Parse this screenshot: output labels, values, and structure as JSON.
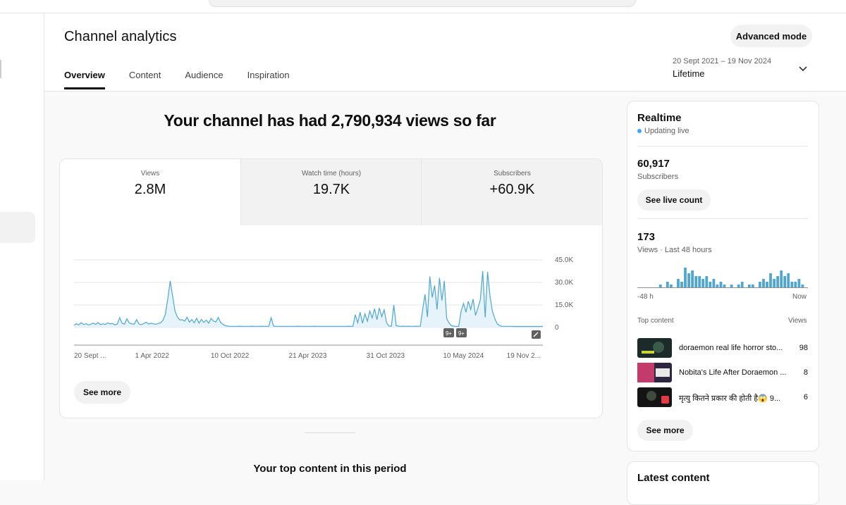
{
  "header": {
    "title": "Channel analytics",
    "advanced_button": "Advanced mode",
    "tabs": [
      {
        "label": "Overview"
      },
      {
        "label": "Content"
      },
      {
        "label": "Audience"
      },
      {
        "label": "Inspiration"
      }
    ],
    "date_range": "20 Sept 2021 – 19 Nov 2024",
    "date_label": "Lifetime"
  },
  "main": {
    "headline": "Your channel has had 2,790,934 views so far",
    "metrics": [
      {
        "label": "Views",
        "value": "2.8M"
      },
      {
        "label": "Watch time (hours)",
        "value": "19.7K"
      },
      {
        "label": "Subscribers",
        "value": "+60.9K"
      }
    ],
    "see_more": "See more",
    "top_content_title": "Your top content in this period",
    "badges": [
      "9+",
      "9+"
    ]
  },
  "chart_data": {
    "type": "line",
    "x_ticks": [
      "20 Sept ...",
      "1 Apr 2022",
      "10 Oct 2022",
      "21 Apr 2023",
      "31 Oct 2023",
      "10 May 2024",
      "19 Nov 2..."
    ],
    "y_ticks": [
      "45.0K",
      "30.0K",
      "15.0K",
      "0"
    ],
    "ylim": [
      0,
      45000
    ],
    "series": [
      {
        "color": "#4fa6cf",
        "values": [
          1500,
          2500,
          1800,
          3200,
          2000,
          2600,
          1700,
          2200,
          2900,
          2100,
          3300,
          1900,
          2500,
          2000,
          3100,
          2400,
          2700,
          1800,
          2300,
          6500,
          2900,
          2200,
          5800,
          3000,
          2500,
          2200,
          5200,
          2400,
          1900,
          2600,
          3500,
          2300,
          2800,
          2500,
          2100,
          2700,
          3200,
          4800,
          9000,
          19000,
          31000,
          21000,
          11000,
          7000,
          5000,
          5200,
          4200,
          6800,
          3600,
          5300,
          3100,
          6200,
          2900,
          5400,
          3400,
          4900,
          2800,
          6100,
          4300,
          3700,
          6700,
          3300,
          2000,
          1200,
          900,
          800,
          800,
          800,
          800,
          900,
          800,
          800,
          800,
          800,
          900,
          800,
          800,
          800,
          900,
          800,
          800,
          800,
          6500,
          900,
          800,
          800,
          800,
          800,
          800,
          800,
          800,
          800,
          800,
          900,
          800,
          800,
          800,
          800,
          800,
          800,
          900,
          800,
          800,
          800,
          800,
          800,
          800,
          800,
          800,
          800,
          800,
          800,
          800,
          800,
          900,
          800,
          800,
          8500,
          3200,
          10200,
          2800,
          9100,
          4200,
          11000,
          6400,
          12500,
          5200,
          13000,
          7200,
          11800,
          3200,
          1000,
          900,
          15000,
          1200,
          900,
          800,
          900,
          800,
          900,
          800,
          800,
          900,
          800,
          800,
          12000,
          22000,
          7000,
          34000,
          20000,
          28000,
          12000,
          33000,
          18000,
          31000,
          6000,
          3000,
          1200,
          900,
          800,
          700,
          11000,
          16000,
          10200,
          17500,
          12000,
          19000,
          8000,
          13000,
          18500,
          37500,
          6800,
          37000,
          21000,
          11000,
          6000,
          2500,
          1200,
          800,
          800,
          800,
          800,
          800,
          700,
          700,
          700,
          700,
          700,
          700,
          700,
          700,
          700,
          700,
          700,
          700,
          700
        ]
      }
    ]
  },
  "realtime": {
    "title": "Realtime",
    "status": "Updating live",
    "subscribers": "60,917",
    "subscribers_label": "Subscribers",
    "live_button": "See live count",
    "views": "173",
    "views_label": "Views · Last 48 hours",
    "mini_chart": {
      "values": [
        0,
        0,
        0,
        0,
        0,
        0,
        1,
        0,
        2,
        1,
        0,
        3,
        2,
        7,
        5,
        6,
        4,
        4,
        3,
        4,
        2,
        3,
        1,
        2,
        1,
        0,
        1,
        0,
        1,
        2,
        0,
        1,
        1,
        0,
        2,
        3,
        2,
        5,
        3,
        4,
        6,
        4,
        5,
        2,
        2,
        3,
        1,
        0
      ],
      "left_label": "-48 h",
      "right_label": "Now"
    },
    "top_content_label": "Top content",
    "views_col_label": "Views",
    "top_content": [
      {
        "title": "doraemon real life horror sto...",
        "views": "98",
        "thumb_color": "#1c2a2a"
      },
      {
        "title": "Nobita's Life After Doraemon ...",
        "views": "8",
        "thumb_color": "#2e2540"
      },
      {
        "title": "मृत्यु कितने प्रकार की होती है😱 9...",
        "views": "6",
        "thumb_color": "#141414"
      }
    ],
    "see_more": "See more"
  },
  "latest": {
    "title": "Latest content"
  }
}
